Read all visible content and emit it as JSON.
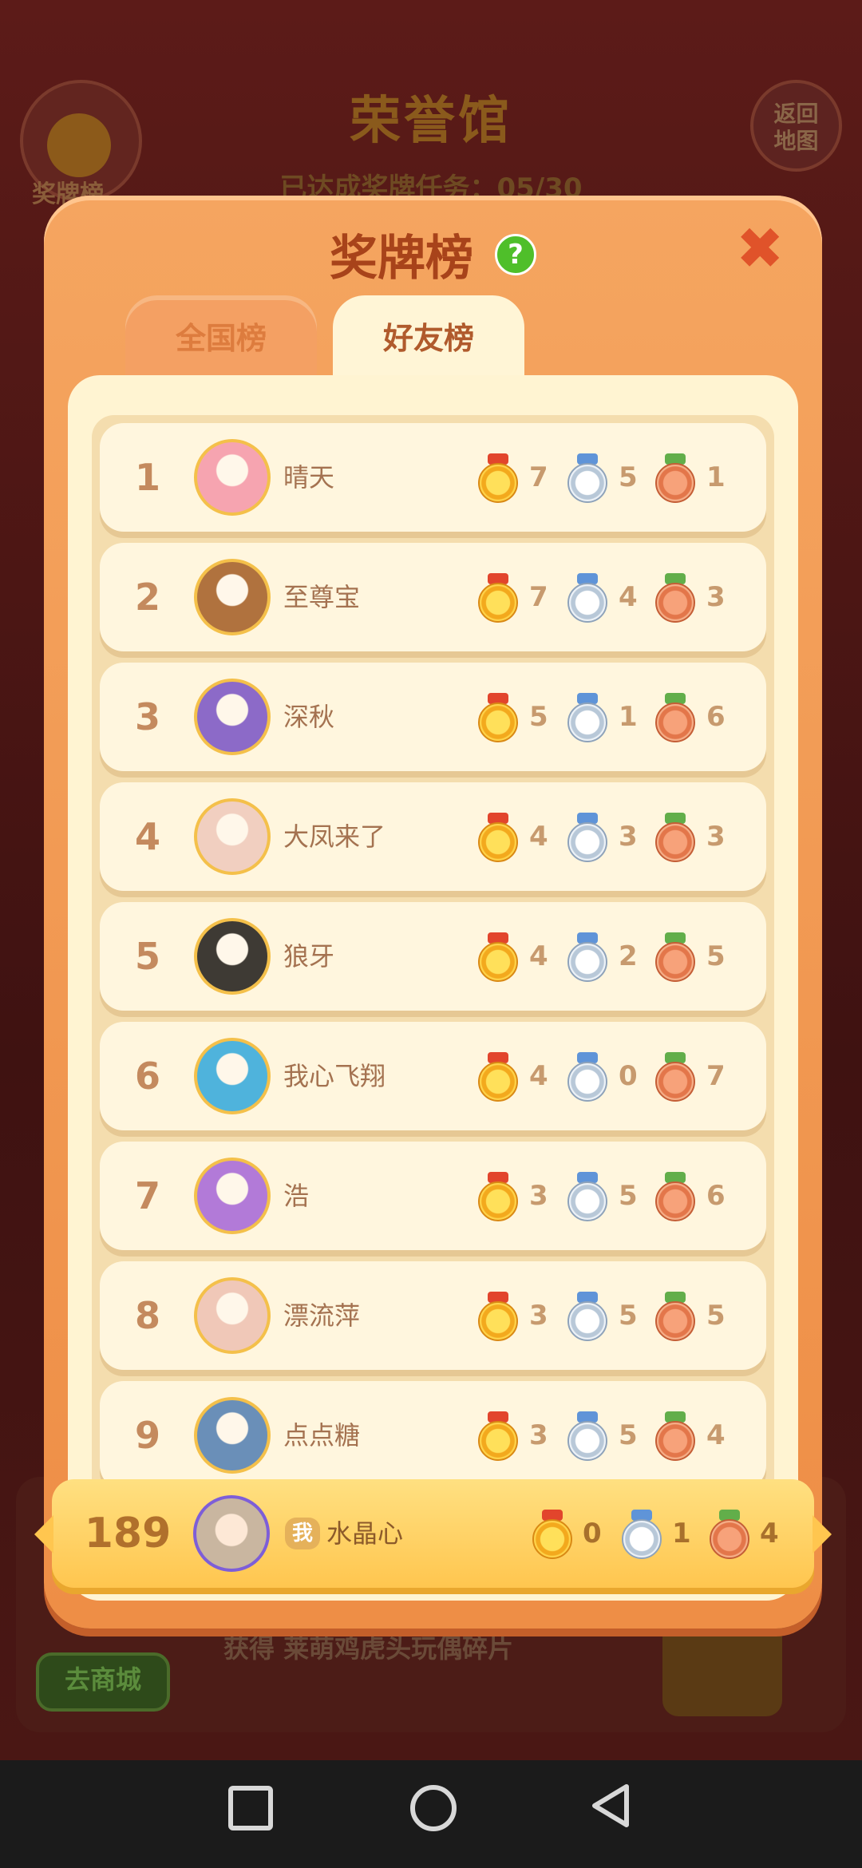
{
  "background": {
    "title": "荣誉馆",
    "progress_label": "已达成奖牌任务：",
    "progress_value": "05/30",
    "badge_button_label": "奖牌榜",
    "return_button_line1": "返回",
    "return_button_line2": "地图",
    "shop_button": "去商城",
    "reward_text": "获得 莱萌鸡虎头玩偶碎片"
  },
  "modal": {
    "title": "奖牌榜",
    "help_symbol": "?",
    "close_symbol": "✖",
    "tabs": [
      {
        "label": "全国榜",
        "active": false
      },
      {
        "label": "好友榜",
        "active": true
      }
    ]
  },
  "leaderboard": [
    {
      "rank": "1",
      "name": "晴天",
      "gold": "7",
      "silver": "5",
      "bronze": "1",
      "avatar_color": "#f6a4b0"
    },
    {
      "rank": "2",
      "name": "至尊宝",
      "gold": "7",
      "silver": "4",
      "bronze": "3",
      "avatar_color": "#b0723e"
    },
    {
      "rank": "3",
      "name": "深秋",
      "gold": "5",
      "silver": "1",
      "bronze": "6",
      "avatar_color": "#8c6ac8"
    },
    {
      "rank": "4",
      "name": "大凤来了",
      "gold": "4",
      "silver": "3",
      "bronze": "3",
      "avatar_color": "#f1cfc0"
    },
    {
      "rank": "5",
      "name": "狼牙",
      "gold": "4",
      "silver": "2",
      "bronze": "5",
      "avatar_color": "#3e3a34"
    },
    {
      "rank": "6",
      "name": "我心飞翔",
      "gold": "4",
      "silver": "0",
      "bronze": "7",
      "avatar_color": "#4fb3dc"
    },
    {
      "rank": "7",
      "name": "浩",
      "gold": "3",
      "silver": "5",
      "bronze": "6",
      "avatar_color": "#b27ad8"
    },
    {
      "rank": "8",
      "name": "漂流萍",
      "gold": "3",
      "silver": "5",
      "bronze": "5",
      "avatar_color": "#f0c8b8"
    },
    {
      "rank": "9",
      "name": "点点糖",
      "gold": "3",
      "silver": "5",
      "bronze": "4",
      "avatar_color": "#6a8fb8"
    }
  ],
  "my_entry": {
    "rank": "189",
    "me_badge": "我",
    "name": "水晶心",
    "gold": "0",
    "silver": "1",
    "bronze": "4",
    "avatar_color": "#c9b6a0"
  },
  "navigation": {
    "buttons": [
      "recent-apps",
      "home",
      "back"
    ]
  }
}
